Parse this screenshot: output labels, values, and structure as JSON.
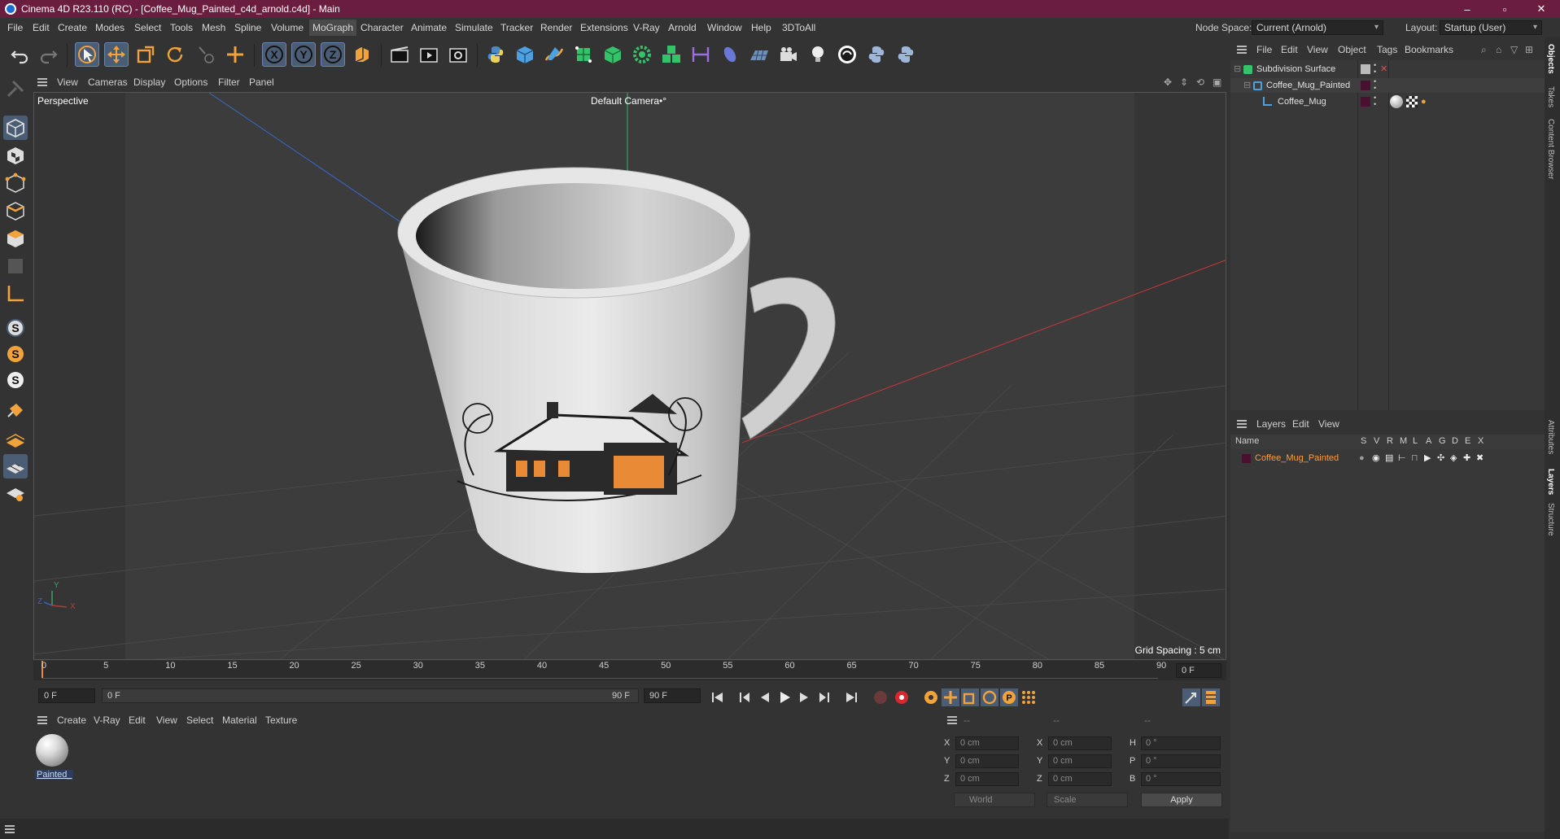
{
  "title": "Cinema 4D R23.110 (RC) - [Coffee_Mug_Painted_c4d_arnold.c4d] - Main",
  "window_controls": {
    "minimize": "–",
    "maximize": "▫",
    "close": "✕"
  },
  "menubar": {
    "items": [
      "File",
      "Edit",
      "Create",
      "Modes",
      "Select",
      "Tools",
      "Mesh",
      "Spline",
      "Volume",
      "MoGraph",
      "Character",
      "Animate",
      "Simulate",
      "Tracker",
      "Render",
      "Extensions",
      "V-Ray",
      "Arnold",
      "Window",
      "Help",
      "3DToAll"
    ],
    "active": "MoGraph",
    "node_space_label": "Node Space:",
    "node_space_value": "Current (Arnold)",
    "layout_label": "Layout:",
    "layout_value": "Startup (User)"
  },
  "viewport": {
    "menu": [
      "View",
      "Cameras",
      "Display",
      "Options",
      "Filter",
      "Panel"
    ],
    "view_name": "Perspective",
    "camera": "Default Camera",
    "camera_suffix": "•°",
    "grid_spacing": "Grid Spacing : 5 cm",
    "axis_labels": {
      "x": "X",
      "y": "Y",
      "z": "Z"
    }
  },
  "timeline": {
    "ticks": [
      "0",
      "5",
      "10",
      "15",
      "20",
      "25",
      "30",
      "35",
      "40",
      "45",
      "50",
      "55",
      "60",
      "65",
      "70",
      "75",
      "80",
      "85",
      "90"
    ],
    "current_frame": "0 F",
    "start_field": "0 F",
    "range_start": "0 F",
    "range_end": "90 F",
    "end_field": "90 F"
  },
  "material_manager": {
    "menu": [
      "Create",
      "V-Ray",
      "Edit",
      "View",
      "Select",
      "Material",
      "Texture"
    ],
    "materials": [
      {
        "name": "Painted_"
      }
    ]
  },
  "coordinates": {
    "header": [
      "--",
      "--",
      "--"
    ],
    "rows": [
      {
        "l1": "X",
        "v1": "0 cm",
        "l2": "X",
        "v2": "0 cm",
        "l3": "H",
        "v3": "0 °"
      },
      {
        "l1": "Y",
        "v1": "0 cm",
        "l2": "Y",
        "v2": "0 cm",
        "l3": "P",
        "v3": "0 °"
      },
      {
        "l1": "Z",
        "v1": "0 cm",
        "l2": "Z",
        "v2": "0 cm",
        "l3": "B",
        "v3": "0 °"
      }
    ],
    "space": "World",
    "mode": "Scale",
    "apply": "Apply"
  },
  "objects_panel": {
    "menu": [
      "File",
      "Edit",
      "View",
      "Object",
      "Tags",
      "Bookmarks"
    ],
    "tree": [
      {
        "name": "Subdivision Surface",
        "indent": 0
      },
      {
        "name": "Coffee_Mug_Painted",
        "indent": 1
      },
      {
        "name": "Coffee_Mug",
        "indent": 2
      }
    ]
  },
  "layers_panel": {
    "menu": [
      "Layers",
      "Edit",
      "View"
    ],
    "header_name": "Name",
    "header_cols": [
      "S",
      "V",
      "R",
      "M",
      "L",
      "A",
      "G",
      "D",
      "E",
      "X"
    ],
    "layers": [
      {
        "name": "Coffee_Mug_Painted",
        "color": "#ff9a3c"
      }
    ]
  },
  "right_tabs": [
    "Objects",
    "Takes",
    "Content Browser",
    "Attributes",
    "Layers",
    "Structure"
  ],
  "colors": {
    "accent": "#6b1d40",
    "selection": "#4b5d75",
    "layer_name": "#ff9a3c"
  }
}
